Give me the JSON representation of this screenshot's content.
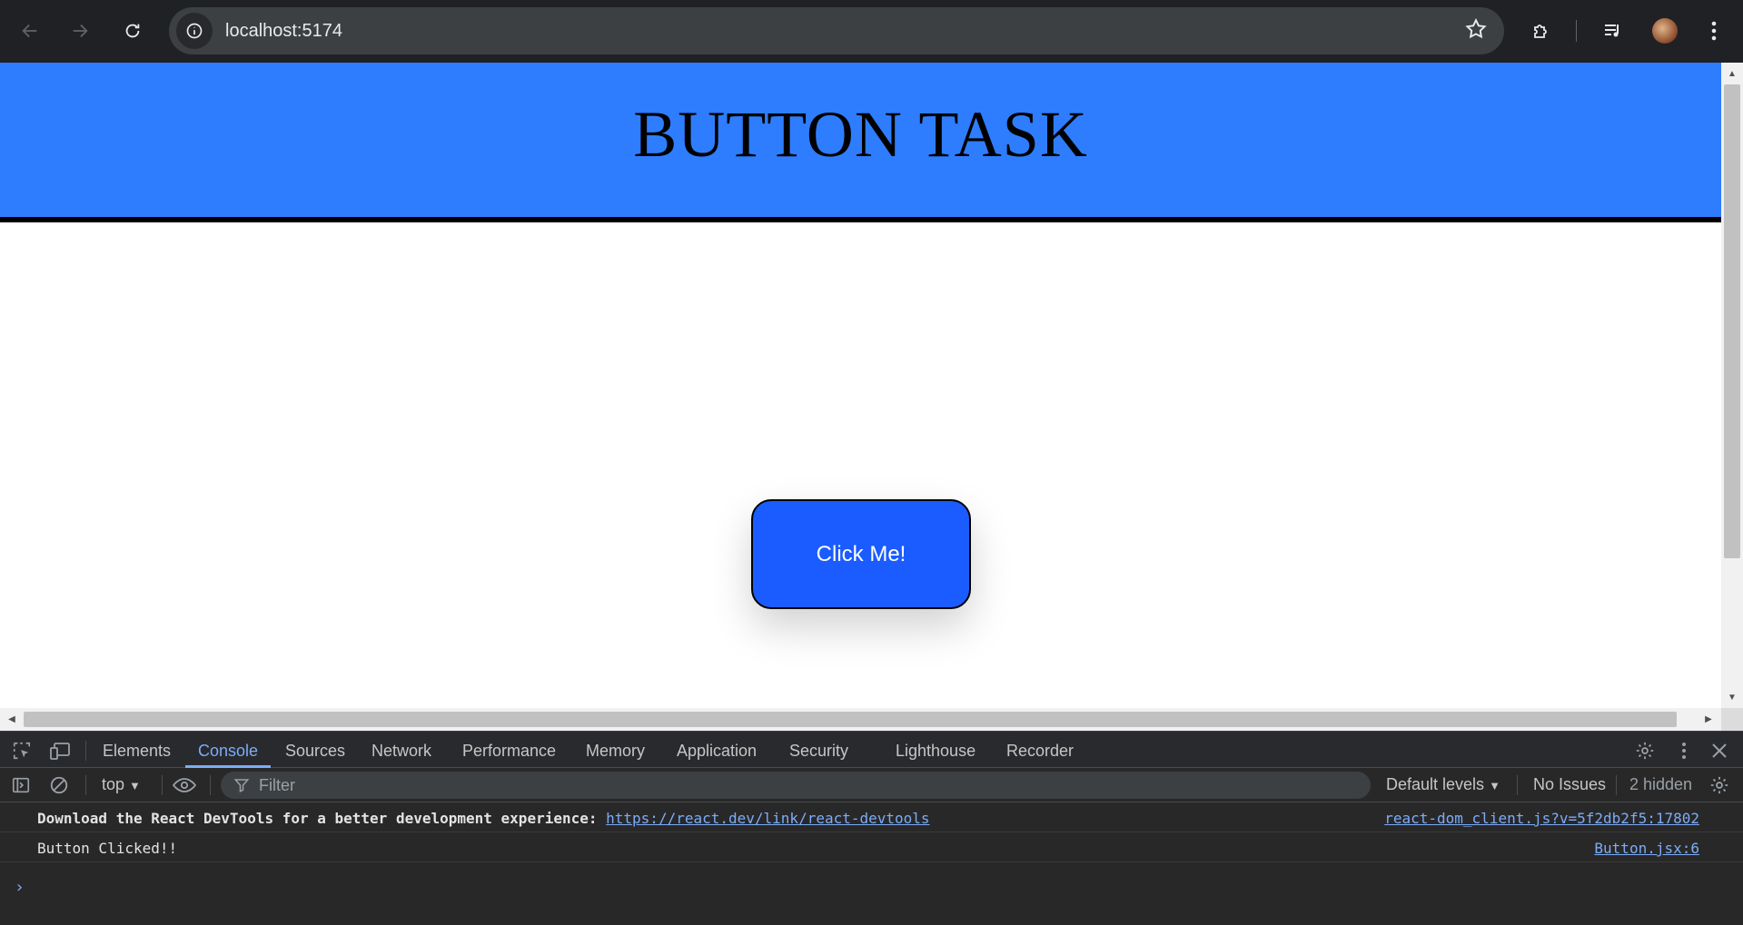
{
  "browser": {
    "url": "localhost:5174"
  },
  "page": {
    "heading": "BUTTON TASK",
    "button_label": "Click Me!"
  },
  "devtools": {
    "tabs": [
      {
        "label": "Elements"
      },
      {
        "label": "Console",
        "active": true
      },
      {
        "label": "Sources"
      },
      {
        "label": "Network"
      },
      {
        "label": "Performance"
      },
      {
        "label": "Memory"
      },
      {
        "label": "Application"
      },
      {
        "label": "Security"
      },
      {
        "label": "Lighthouse"
      },
      {
        "label": "Recorder"
      }
    ],
    "toolbar": {
      "context": "top",
      "filter_placeholder": "Filter",
      "levels": "Default levels",
      "issues": "No Issues",
      "hidden": "2 hidden"
    },
    "messages": [
      {
        "text": "Download the React DevTools for a better development experience: ",
        "link": "https://react.dev/link/react-devtools",
        "source": "react-dom_client.js?v=5f2db2f5:17802"
      },
      {
        "text": "Button Clicked!!",
        "source": "Button.jsx:6"
      }
    ]
  },
  "colors": {
    "header_band": "#2e7dff",
    "button": "#1a5cff",
    "devtools_accent": "#7cacf8"
  }
}
